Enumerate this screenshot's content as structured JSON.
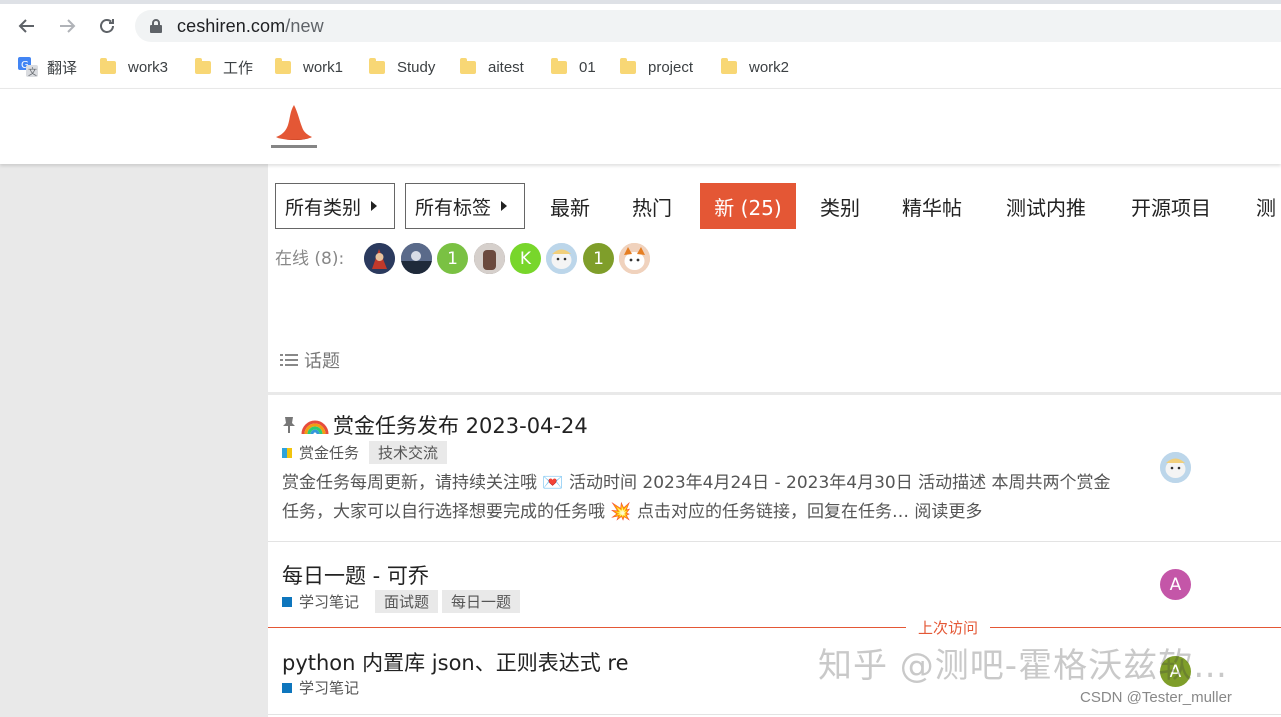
{
  "browser": {
    "url_domain": "ceshiren.com",
    "url_path": "/new",
    "bookmarks": [
      {
        "label": "翻译",
        "icon": "google-translate-icon"
      },
      {
        "label": "work3",
        "icon": "folder-icon"
      },
      {
        "label": "工作",
        "icon": "folder-icon"
      },
      {
        "label": "work1",
        "icon": "folder-icon"
      },
      {
        "label": "Study",
        "icon": "folder-icon"
      },
      {
        "label": "aitest",
        "icon": "folder-icon"
      },
      {
        "label": "01",
        "icon": "folder-icon"
      },
      {
        "label": "project",
        "icon": "folder-icon"
      },
      {
        "label": "work2",
        "icon": "folder-icon"
      }
    ]
  },
  "filters": {
    "category_label": "所有类别",
    "tag_label": "所有标签"
  },
  "nav": {
    "tabs": [
      {
        "label": "最新",
        "active": false
      },
      {
        "label": "热门",
        "active": false
      },
      {
        "label": "新 (25)",
        "active": true
      },
      {
        "label": "类别",
        "active": false
      },
      {
        "label": "精华帖",
        "active": false
      },
      {
        "label": "测试内推",
        "active": false
      },
      {
        "label": "开源项目",
        "active": false
      },
      {
        "label": "测",
        "active": false
      }
    ]
  },
  "online": {
    "label": "在线 (8):",
    "users": [
      {
        "initial": "",
        "color": "#3b4a6b"
      },
      {
        "initial": "",
        "color": "#46536e"
      },
      {
        "initial": "1",
        "color": "#7ac143"
      },
      {
        "initial": "",
        "color": "#7a6e68"
      },
      {
        "initial": "K",
        "color": "#78d62b"
      },
      {
        "initial": "",
        "color": "#cfe3f1"
      },
      {
        "initial": "1",
        "color": "#7f9e2a"
      },
      {
        "initial": "",
        "color": "#f2c9a8"
      }
    ]
  },
  "topic_list": {
    "header": "话题",
    "last_visit_label": "上次访问",
    "topics": [
      {
        "pinned": true,
        "title": "赏金任务发布 2023-04-24",
        "category": "赏金任务",
        "category_color": "#2ea3db",
        "tags": [
          "技术交流"
        ],
        "excerpt": "赏金任务每周更新，请持续关注哦 💌 活动时间 2023年4月24日 - 2023年4月30日 活动描述 本周共两个赏金任务，大家可以自行选择想要完成的任务哦 💥 点击对应的任务链接，回复在任务… 阅读更多",
        "avatar_initial": "",
        "avatar_color": "#cfe3f1"
      },
      {
        "pinned": false,
        "title": "每日一题 - 可乔",
        "category": "学习笔记",
        "category_color": "#0e76bd",
        "tags": [
          "面试题",
          "每日一题"
        ],
        "excerpt": "",
        "avatar_initial": "A",
        "avatar_color": "#c456a8"
      },
      {
        "pinned": false,
        "title": "python 内置库 json、正则表达式 re",
        "category": "学习笔记",
        "category_color": "#0e76bd",
        "tags": [],
        "excerpt": "",
        "avatar_initial": "A",
        "avatar_color": "#7f9e2a"
      }
    ]
  },
  "watermark": {
    "zhihu": "知乎 @测吧-霍格沃兹软…",
    "csdn": "CSDN @Tester_muller"
  }
}
